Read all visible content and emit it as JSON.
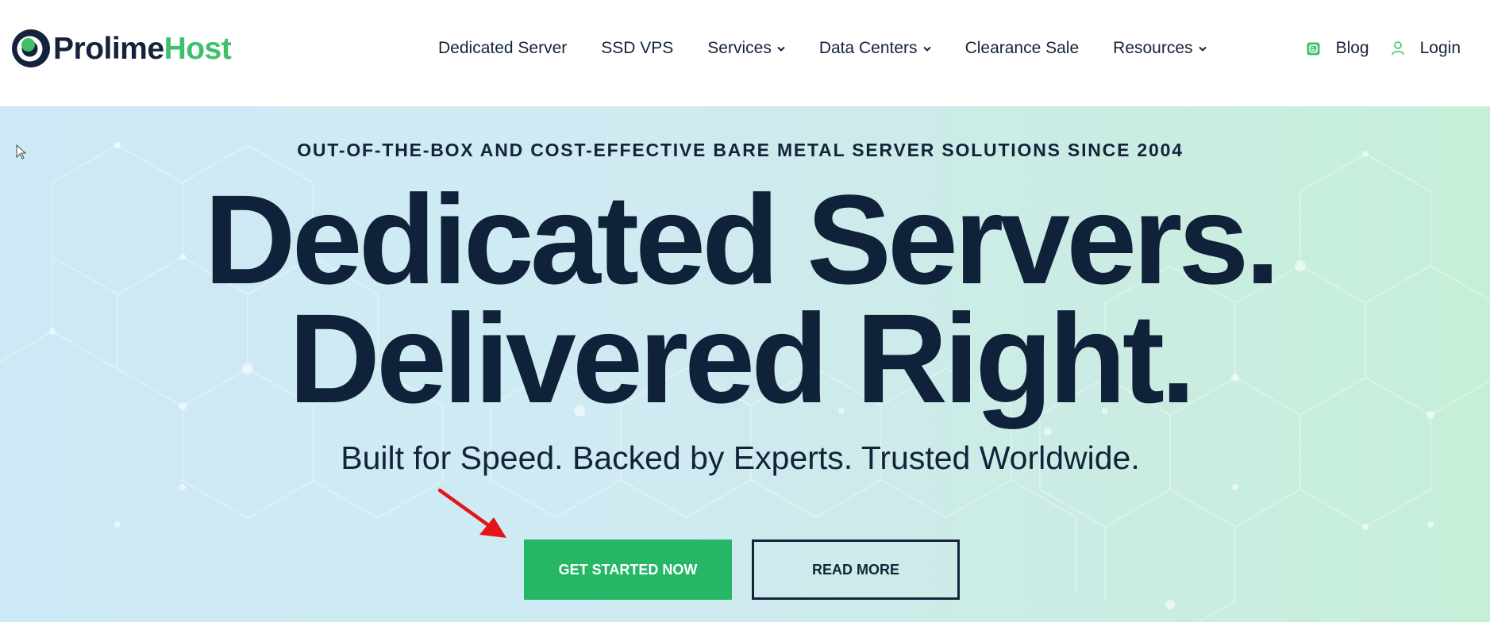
{
  "logo": {
    "part1": "Prolime",
    "part2": "Host"
  },
  "nav": {
    "items": [
      {
        "label": "Dedicated Server",
        "dropdown": false
      },
      {
        "label": "SSD VPS",
        "dropdown": false
      },
      {
        "label": "Services",
        "dropdown": true
      },
      {
        "label": "Data Centers",
        "dropdown": true
      },
      {
        "label": "Clearance Sale",
        "dropdown": false
      },
      {
        "label": "Resources",
        "dropdown": true
      }
    ],
    "blog": {
      "label": "Blog",
      "icon": "blog-icon"
    },
    "login": {
      "label": "Login",
      "icon": "user-icon"
    }
  },
  "hero": {
    "eyebrow": "OUT-OF-THE-BOX AND COST-EFFECTIVE BARE METAL SERVER SOLUTIONS SINCE 2004",
    "headline_line1": "Dedicated Servers.",
    "headline_line2": "Delivered Right.",
    "subheadline": "Built for Speed. Backed by Experts. Trusted Worldwide.",
    "primary_button": "GET STARTED NOW",
    "secondary_button": "READ MORE"
  },
  "colors": {
    "brand_dark": "#14233a",
    "brand_green": "#3dbf6e",
    "button_green": "#26b766",
    "annotation_arrow": "#e5141b"
  }
}
